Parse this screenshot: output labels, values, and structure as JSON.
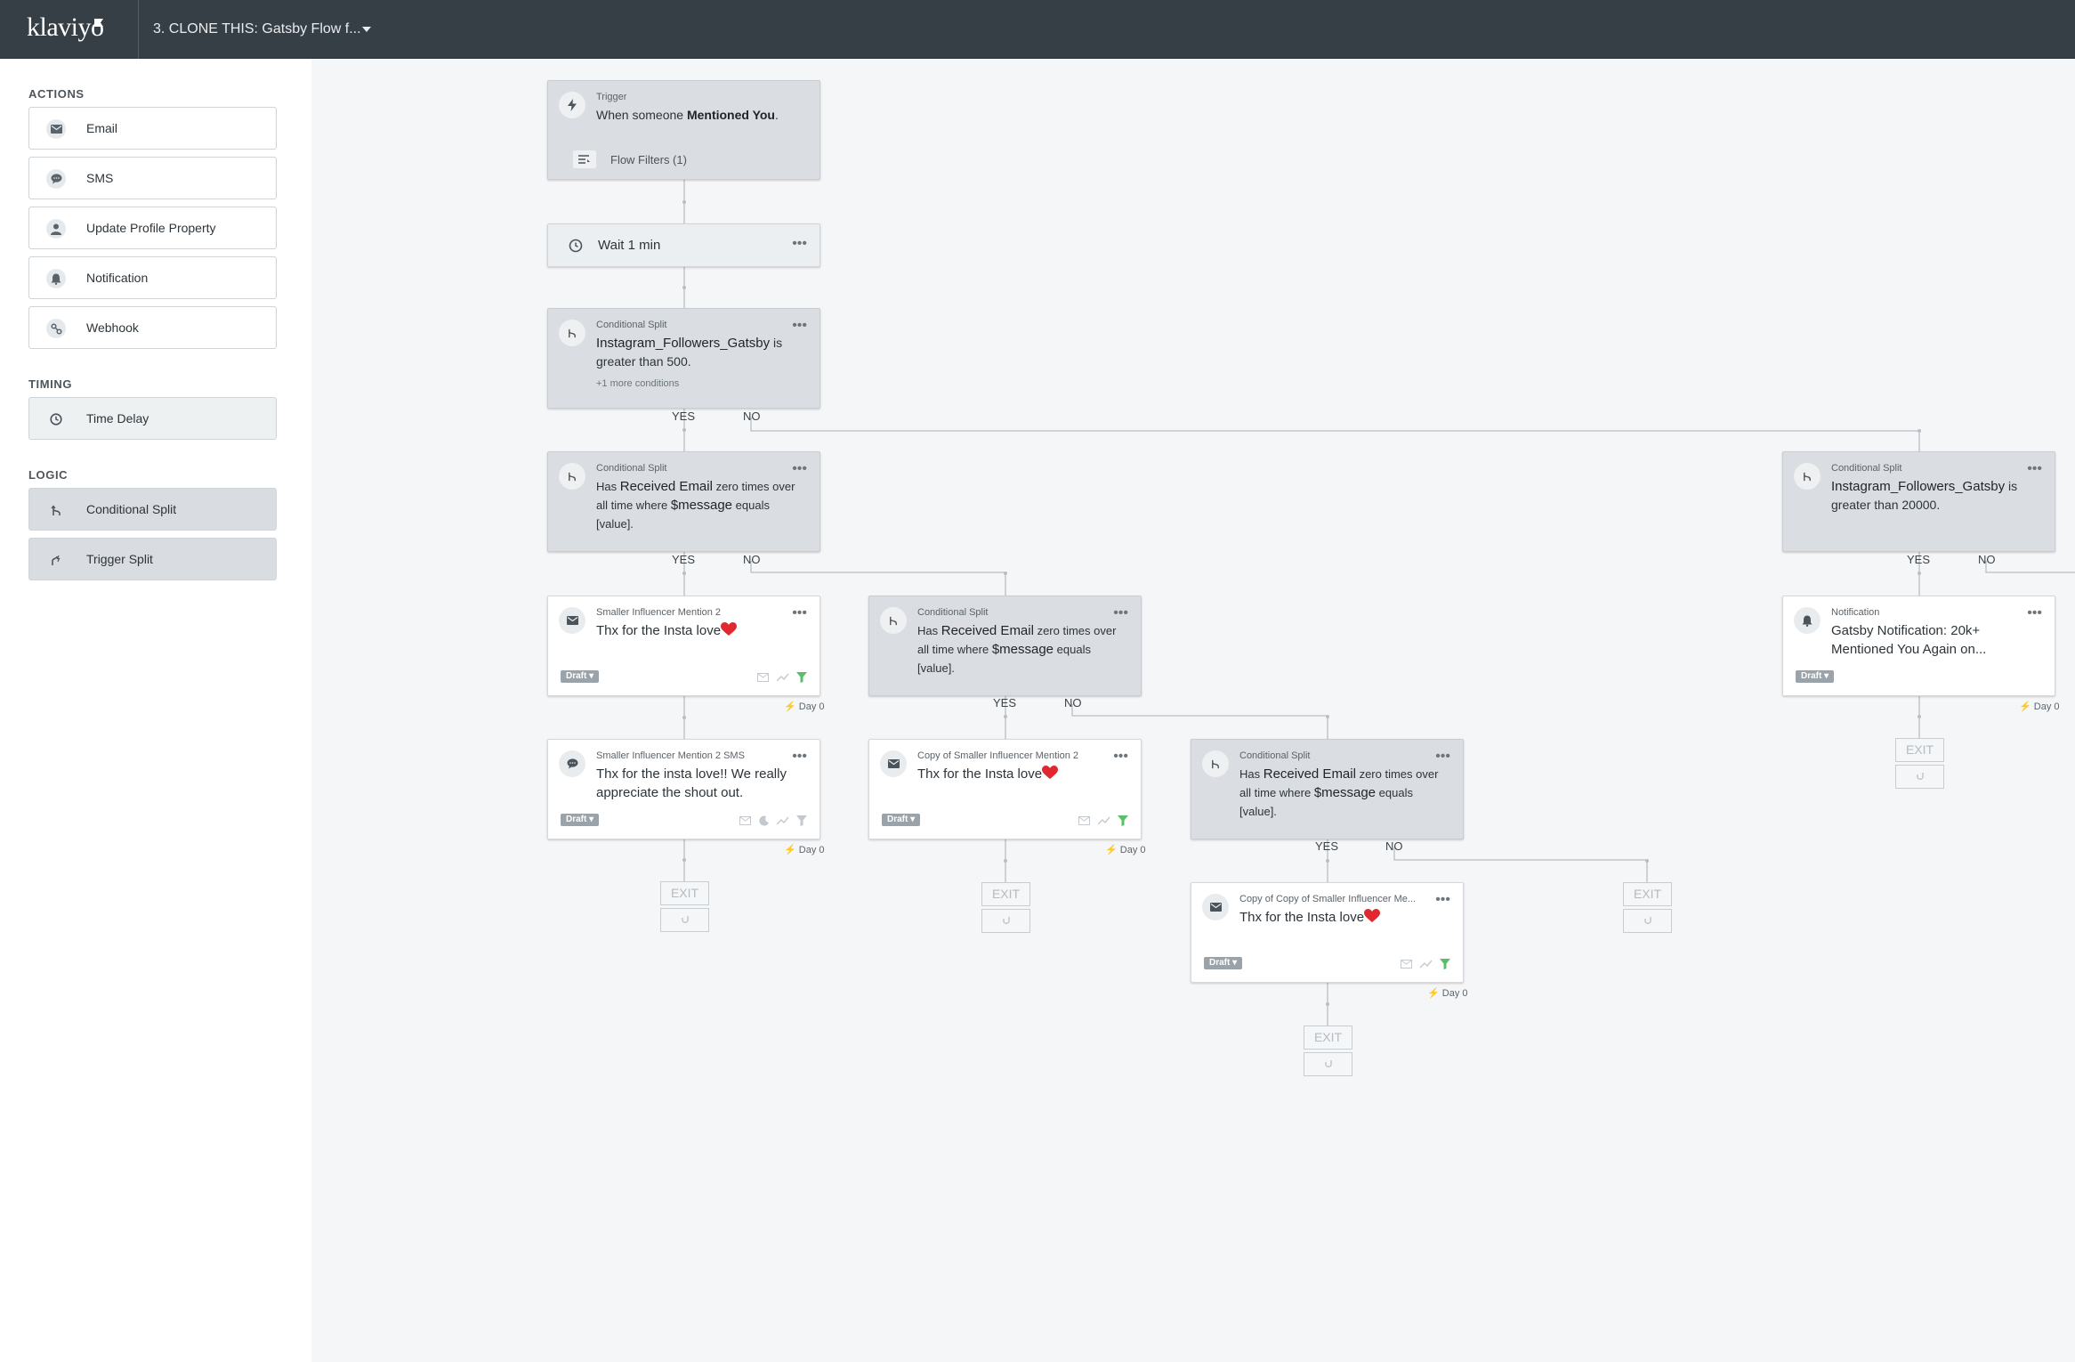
{
  "header": {
    "logo": "klaviyo",
    "flow_title": "3. CLONE THIS: Gatsby Flow f..."
  },
  "sidebar": {
    "actions_title": "ACTIONS",
    "actions": [
      {
        "label": "Email",
        "icon": "envelope-icon"
      },
      {
        "label": "SMS",
        "icon": "chat-bubble-icon"
      },
      {
        "label": "Update Profile Property",
        "icon": "person-icon"
      },
      {
        "label": "Notification",
        "icon": "bell-icon"
      },
      {
        "label": "Webhook",
        "icon": "webhook-icon"
      }
    ],
    "timing_title": "TIMING",
    "timing": [
      {
        "label": "Time Delay",
        "icon": "clock-icon"
      }
    ],
    "logic_title": "LOGIC",
    "logic": [
      {
        "label": "Conditional Split",
        "icon": "split-icon"
      },
      {
        "label": "Trigger Split",
        "icon": "trigger-split-icon"
      }
    ]
  },
  "flow": {
    "trigger": {
      "label": "Trigger",
      "prefix": "When someone ",
      "metric": "Mentioned You",
      "suffix": ".",
      "filters": "Flow Filters (1)"
    },
    "wait": {
      "text": "Wait 1 min"
    },
    "split1": {
      "label": "Conditional Split",
      "field": "Instagram_Followers_Gatsby",
      "rest": " is greater than 500.",
      "more": "+1 more conditions"
    },
    "split2": {
      "label": "Conditional Split",
      "pre": "Has ",
      "metric": "Received Email",
      "mid": " zero times over all time where ",
      "var": "$message",
      "post": " equals [value]."
    },
    "split3": {
      "label": "Conditional Split",
      "pre": "Has ",
      "metric": "Received Email",
      "mid": " zero times over all time where ",
      "var": "$message",
      "post": " equals [value]."
    },
    "split4": {
      "label": "Conditional Split",
      "pre": "Has ",
      "metric": "Received Email",
      "mid": " zero times over all time where ",
      "var": "$message",
      "post": " equals [value]."
    },
    "split5": {
      "label": "Conditional Split",
      "field": "Instagram_Followers_Gatsby",
      "rest": " is greater than 20000."
    },
    "email1": {
      "label": "Smaller Influencer Mention 2",
      "text": "Thx for the Insta love",
      "status": "Draft",
      "day": "Day 0"
    },
    "sms1": {
      "label": "Smaller Influencer Mention 2 SMS",
      "text": "Thx for the insta love!! We really appreciate the shout out.",
      "status": "Draft",
      "day": "Day 0"
    },
    "email2": {
      "label": "Copy of Smaller Influencer Mention 2",
      "text": "Thx for the Insta love",
      "status": "Draft",
      "day": "Day 0"
    },
    "email3": {
      "label": "Copy of Copy of Smaller Influencer Me...",
      "text": "Thx for the Insta love",
      "status": "Draft",
      "day": "Day 0"
    },
    "notif1": {
      "label": "Notification",
      "text": "Gatsby Notification: 20k+ Mentioned You Again on...",
      "status": "Draft",
      "day": "Day 0"
    },
    "yes": "YES",
    "no": "NO",
    "exit": "EXIT"
  },
  "colors": {
    "topbar": "#373f46",
    "canvas": "#f5f6f7",
    "node_gray": "#dadee2",
    "draft_badge": "#9aa3aa",
    "filter_green": "#5bbf6a",
    "heart_red": "#e0282e"
  }
}
